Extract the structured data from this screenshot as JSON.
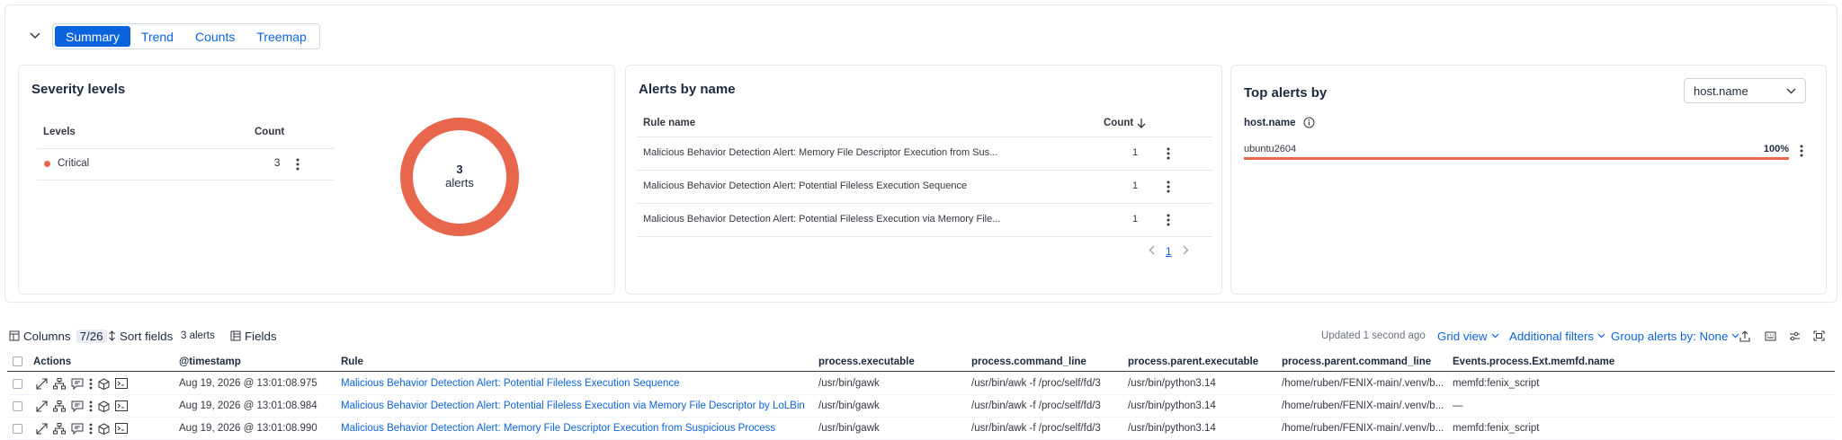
{
  "tabs": [
    "Summary",
    "Trend",
    "Counts",
    "Treemap"
  ],
  "severity": {
    "title": "Severity levels",
    "col_levels": "Levels",
    "col_count": "Count",
    "rows": [
      {
        "level": "Critical",
        "count": "3",
        "color": "#e7664c"
      }
    ],
    "donut_value": "3",
    "donut_unit": "alerts",
    "donut_color": "#e7664c"
  },
  "alerts_by_name": {
    "title": "Alerts by name",
    "col_rule": "Rule name",
    "col_count": "Count",
    "rows": [
      {
        "name": "Malicious Behavior Detection Alert: Memory File Descriptor Execution from Sus...",
        "count": "1"
      },
      {
        "name": "Malicious Behavior Detection Alert: Potential Fileless Execution Sequence",
        "count": "1"
      },
      {
        "name": "Malicious Behavior Detection Alert: Potential Fileless Execution via Memory File...",
        "count": "1"
      }
    ],
    "page": "1"
  },
  "top_alerts": {
    "title": "Top alerts by",
    "select_value": "host.name",
    "field_label": "host.name",
    "rows": [
      {
        "name": "ubuntu2604",
        "percent": "100%",
        "fraction": 1.0
      }
    ],
    "bar_color": "#e7664c"
  },
  "toolbar": {
    "columns_label": "Columns",
    "columns_count": "7/26",
    "sort_label": "Sort fields",
    "alerts_count": "3 alerts",
    "fields_label": "Fields",
    "updated": "Updated 1 second ago",
    "grid_view": "Grid view",
    "additional_filters": "Additional filters",
    "group_by": "Group alerts by: None"
  },
  "table": {
    "headers": [
      "Actions",
      "@timestamp",
      "Rule",
      "process.executable",
      "process.command_line",
      "process.parent.executable",
      "process.parent.command_line",
      "Events.process.Ext.memfd.name"
    ],
    "rows": [
      {
        "timestamp": "Aug 19, 2026 @ 13:01:08.975",
        "rule": "Malicious Behavior Detection Alert: Potential Fileless Execution Sequence",
        "exe": "/usr/bin/gawk",
        "cmd": "/usr/bin/awk -f /proc/self/fd/3",
        "pexe": "/usr/bin/python3.14",
        "pcmd": "/home/ruben/FENIX-main/.venv/b...",
        "memfd": "memfd:fenix_script"
      },
      {
        "timestamp": "Aug 19, 2026 @ 13:01:08.984",
        "rule": "Malicious Behavior Detection Alert: Potential Fileless Execution via Memory File Descriptor by LoLBin",
        "exe": "/usr/bin/gawk",
        "cmd": "/usr/bin/awk -f /proc/self/fd/3",
        "pexe": "/usr/bin/python3.14",
        "pcmd": "/home/ruben/FENIX-main/.venv/b...",
        "memfd": "—"
      },
      {
        "timestamp": "Aug 19, 2026 @ 13:01:08.990",
        "rule": "Malicious Behavior Detection Alert: Memory File Descriptor Execution from Suspicious Process",
        "exe": "/usr/bin/gawk",
        "cmd": "/usr/bin/awk -f /proc/self/fd/3",
        "pexe": "/usr/bin/python3.14",
        "pcmd": "/home/ruben/FENIX-main/.venv/b...",
        "memfd": "memfd:fenix_script"
      }
    ]
  },
  "colors": {
    "accent": "#0b64dd",
    "critical": "#e7664c"
  }
}
